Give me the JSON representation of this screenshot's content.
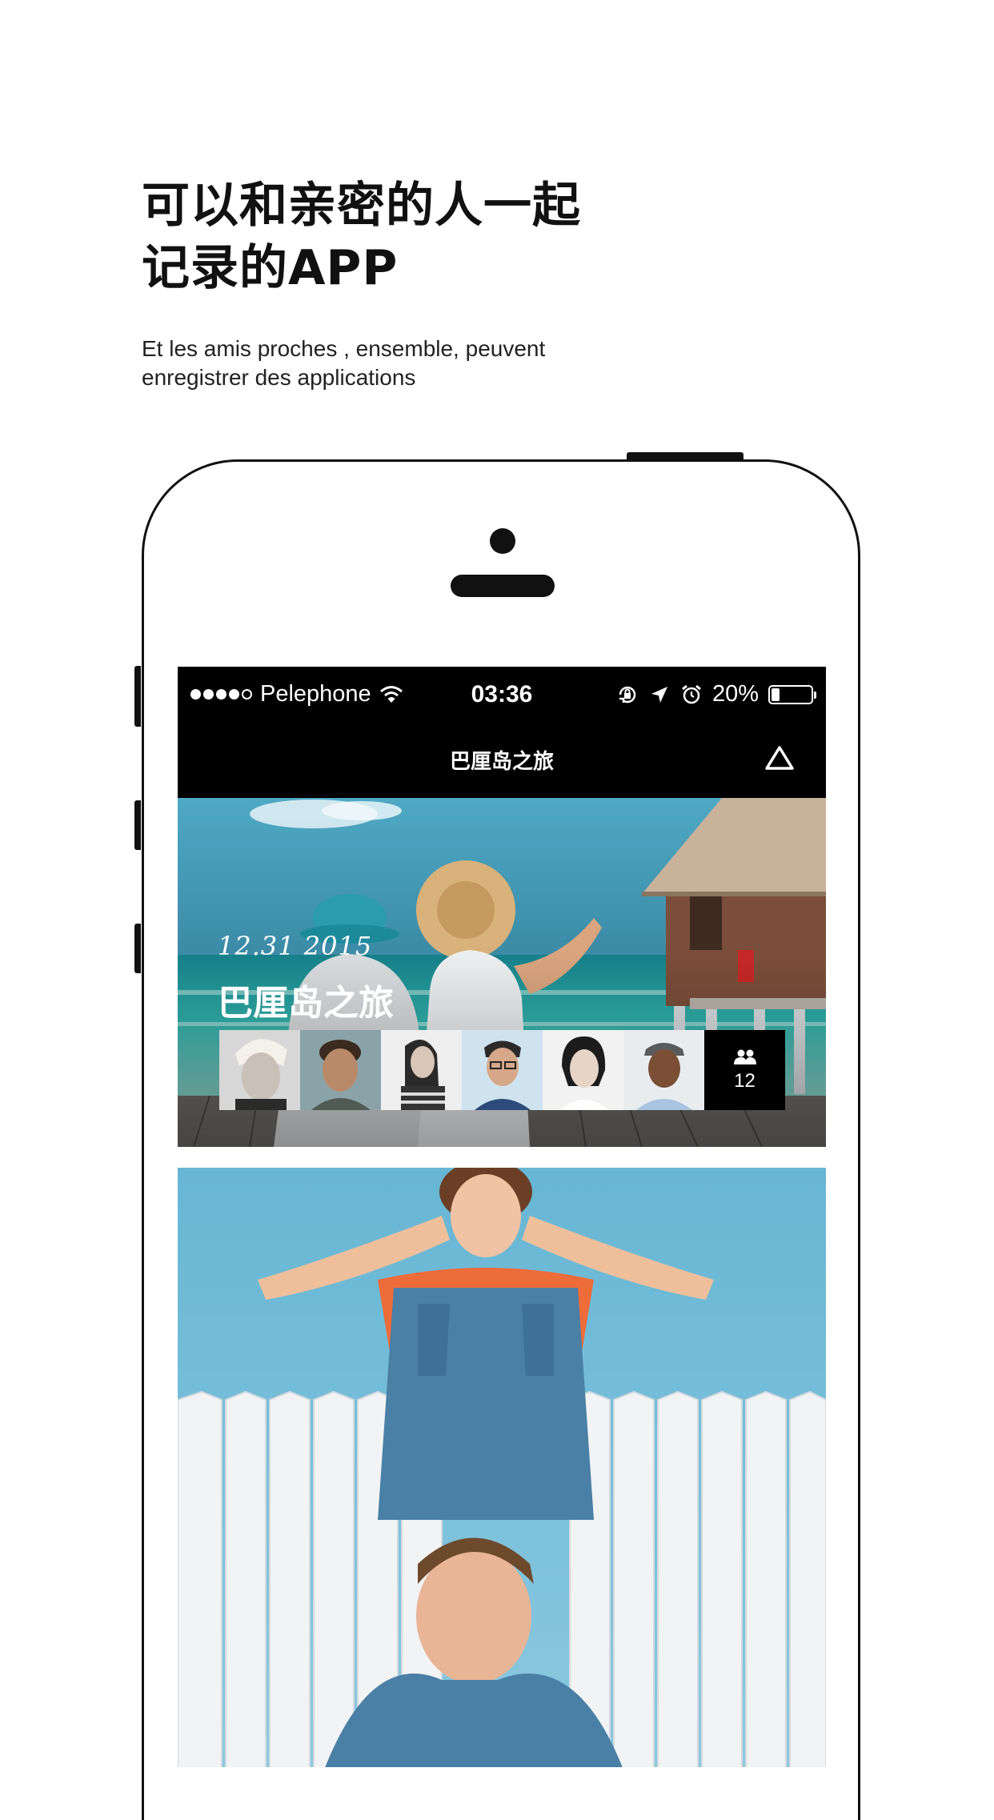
{
  "promo": {
    "headline_line1": "可以和亲密的人一起",
    "headline_line2": "记录的APP",
    "subtitle_line1": "Et les amis proches , ensemble, peuvent",
    "subtitle_line2": "enregistrer des applications"
  },
  "status_bar": {
    "carrier": "Pelephone",
    "signal_bars_filled": 4,
    "signal_bars_total": 5,
    "time": "03:36",
    "battery_percent_label": "20%",
    "battery_level": 0.2,
    "icons": [
      "wifi-icon",
      "rotation-lock-icon",
      "location-arrow-icon",
      "alarm-icon",
      "battery-icon"
    ]
  },
  "nav": {
    "title": "巴厘岛之旅",
    "action_icon": "triangle-up-icon"
  },
  "trips": [
    {
      "date": "12.31  2015",
      "title": "巴厘岛之旅",
      "member_count": "12",
      "member_icon": "people-icon",
      "avatars": [
        "avatar-1",
        "avatar-2",
        "avatar-3",
        "avatar-4",
        "avatar-5",
        "avatar-6"
      ]
    },
    {
      "photo": "couple-at-fence-photo"
    }
  ],
  "colors": {
    "screen_bar": "#000000",
    "sky": "#5fb0cf",
    "sea": "#3cb4b0",
    "white": "#ffffff"
  }
}
